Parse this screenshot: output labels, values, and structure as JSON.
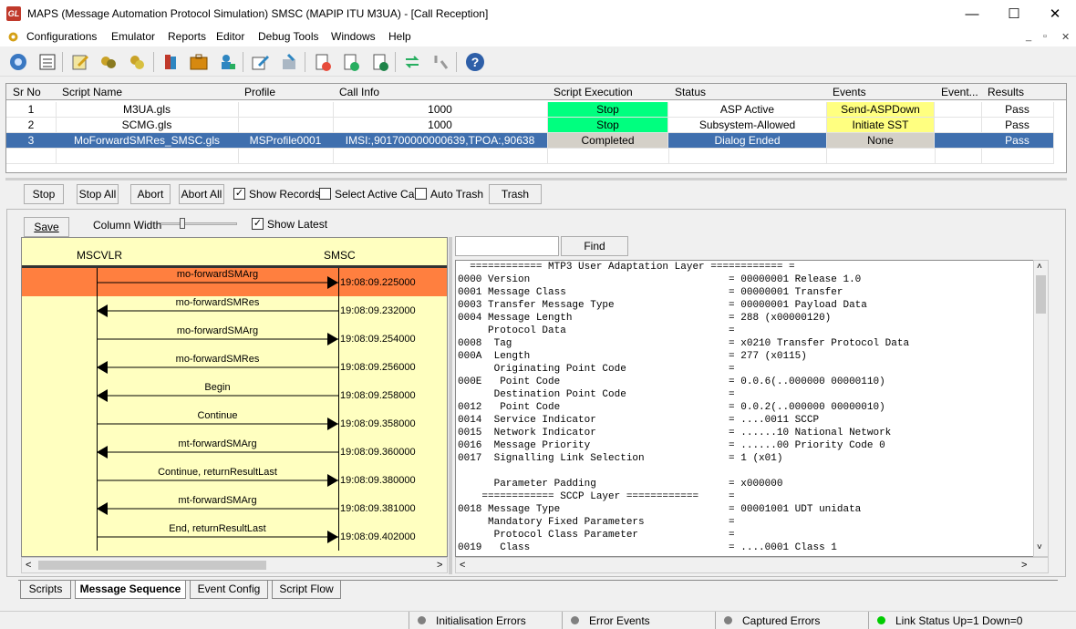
{
  "window": {
    "title": "MAPS (Message Automation Protocol Simulation) SMSC (MAPIP ITU M3UA) - [Call Reception]",
    "app_icon_text": "GL",
    "controls": {
      "minimize": "—",
      "maximize": "☐",
      "close": "✕"
    }
  },
  "menu": {
    "items": [
      "Configurations",
      "Emulator",
      "Reports",
      "Editor",
      "Debug Tools",
      "Windows",
      "Help"
    ],
    "mdi": {
      "minimize": "_",
      "restore": "▫",
      "close": "✕"
    }
  },
  "toolbar": {
    "icons": [
      "gear-icon",
      "list-icon",
      "script-edit-icon",
      "scripts-icon",
      "run-scripts-icon",
      "profile-icon",
      "briefcase-icon",
      "user-config-icon",
      "edit-icon",
      "debug-icon",
      "db-red-icon",
      "db-green-icon",
      "db-blue-icon",
      "refresh-icon",
      "disconnect-icon",
      "help-icon"
    ]
  },
  "grid": {
    "columns": [
      "Sr No",
      "Script Name",
      "Profile",
      "Call Info",
      "Script Execution",
      "Status",
      "Events",
      "Event...",
      "Results"
    ],
    "rows": [
      {
        "sr": "1",
        "script": "M3UA.gls",
        "profile": "",
        "call_info": "1000",
        "execution": "Stop",
        "status": "ASP Active",
        "events": "Send-ASPDown",
        "event_extra": "",
        "results": "Pass"
      },
      {
        "sr": "2",
        "script": "SCMG.gls",
        "profile": "",
        "call_info": "1000",
        "execution": "Stop",
        "status": "Subsystem-Allowed",
        "events": "Initiate SST",
        "event_extra": "",
        "results": "Pass"
      },
      {
        "sr": "3",
        "script": "MoForwardSMRes_SMSC.gls",
        "profile": "MSProfile0001",
        "call_info": "IMSI:,901700000000639,TPOA:,90638",
        "execution": "Completed",
        "status": "Dialog Ended",
        "events": "None",
        "event_extra": "",
        "results": "Pass"
      }
    ]
  },
  "controls": {
    "stop": "Stop",
    "stop_all": "Stop All",
    "abort": "Abort",
    "abort_all": "Abort All",
    "show_records": "Show Records",
    "select_active_call": "Select Active Call",
    "auto_trash": "Auto Trash",
    "trash": "Trash",
    "save": "Save",
    "column_width": "Column Width",
    "show_latest": "Show Latest",
    "find": "Find"
  },
  "sequence": {
    "left_entity": "MSCVLR",
    "right_entity": "SMSC",
    "messages": [
      {
        "label": "mo-forwardSMArg",
        "time": "19:08:09.225000",
        "dir": "right"
      },
      {
        "label": "mo-forwardSMRes",
        "time": "19:08:09.232000",
        "dir": "left"
      },
      {
        "label": "mo-forwardSMArg",
        "time": "19:08:09.254000",
        "dir": "right"
      },
      {
        "label": "mo-forwardSMRes",
        "time": "19:08:09.256000",
        "dir": "left"
      },
      {
        "label": "Begin",
        "time": "19:08:09.258000",
        "dir": "left"
      },
      {
        "label": "Continue",
        "time": "19:08:09.358000",
        "dir": "right"
      },
      {
        "label": "mt-forwardSMArg",
        "time": "19:08:09.360000",
        "dir": "left"
      },
      {
        "label": "Continue, returnResultLast",
        "time": "19:08:09.380000",
        "dir": "right"
      },
      {
        "label": "mt-forwardSMArg",
        "time": "19:08:09.381000",
        "dir": "left"
      },
      {
        "label": "End, returnResultLast",
        "time": "19:08:09.402000",
        "dir": "right"
      }
    ]
  },
  "decode": {
    "lines": [
      "  ============ MTP3 User Adaptation Layer ============ =",
      "0000 Version                                 = 00000001 Release 1.0",
      "0001 Message Class                           = 00000001 Transfer",
      "0003 Transfer Message Type                   = 00000001 Payload Data",
      "0004 Message Length                          = 288 (x00000120)",
      "     Protocol Data                           =",
      "0008  Tag                                    = x0210 Transfer Protocol Data",
      "000A  Length                                 = 277 (x0115)",
      "      Originating Point Code                 =",
      "000E   Point Code                            = 0.0.6(..000000 00000110)",
      "      Destination Point Code                 =",
      "0012   Point Code                            = 0.0.2(..000000 00000010)",
      "0014  Service Indicator                      = ....0011 SCCP",
      "0015  Network Indicator                      = ......10 National Network",
      "0016  Message Priority                       = ......00 Priority Code 0",
      "0017  Signalling Link Selection              = 1 (x01)",
      "",
      "      Parameter Padding                      = x000000",
      "    ============ SCCP Layer ============     =",
      "0018 Message Type                            = 00001001 UDT unidata",
      "     Mandatory Fixed Parameters              =",
      "      Protocol Class Parameter               =",
      "0019   Class                                 = ....0001 Class 1"
    ]
  },
  "tabs": [
    "Scripts",
    "Message Sequence",
    "Event Config",
    "Script Flow"
  ],
  "status": {
    "init_errors": "Initialisation Errors",
    "error_events": "Error Events",
    "captured_errors": "Captured Errors",
    "link_status": "Link Status Up=1 Down=0"
  },
  "colors": {
    "selected_row": "#3f6fae",
    "exec_green": "#00ff7f",
    "event_yellow": "#ffff80",
    "seq_bg": "#ffffc0",
    "seq_highlight": "#ff7f3f",
    "link_ok": "#00cc00"
  }
}
